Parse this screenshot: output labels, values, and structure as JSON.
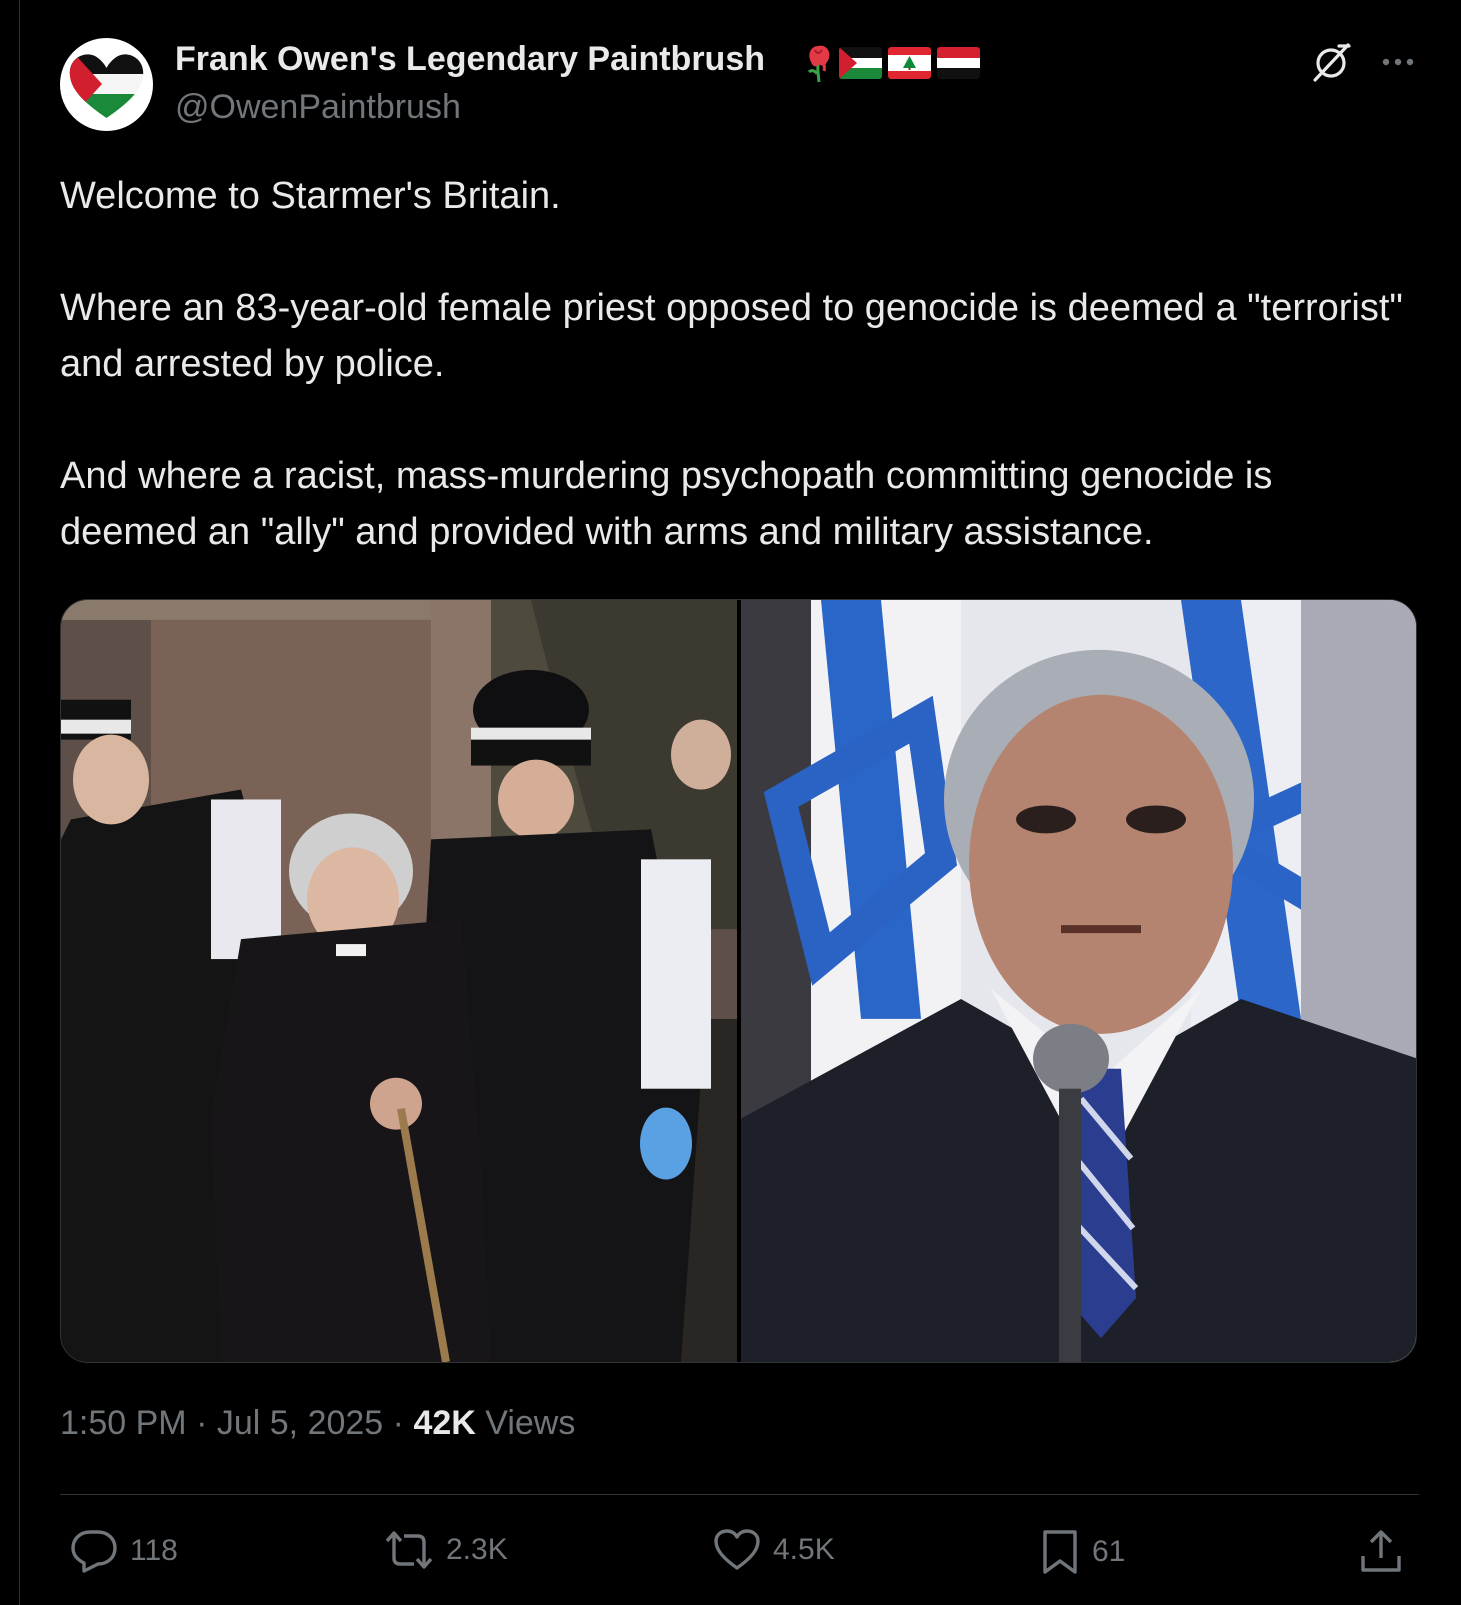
{
  "author": {
    "display_name": "Frank Owen's Legendary Paintbrush",
    "handle": "@OwenPaintbrush"
  },
  "tweet": {
    "paragraphs": [
      "Welcome to Starmer's Britain.",
      "Where an 83-year-old female priest opposed to genocide is deemed a \"terrorist\" and arrested by police.",
      "And where a racist, mass-murdering psychopath committing genocide is deemed an \"ally\" and provided with arms and military assistance."
    ]
  },
  "meta": {
    "time": "1:50 PM",
    "date": "Jul 5, 2025",
    "views_count": "42K",
    "views_label": "Views"
  },
  "actions": {
    "replies": "118",
    "reposts": "2.3K",
    "likes": "4.5K",
    "bookmarks": "61"
  },
  "icons": {
    "avatar": "palestine-flag-heart",
    "badges": [
      "melting-rose",
      "palestine-flag",
      "lebanon-flag",
      "yemen-flag"
    ],
    "header_right": [
      "grok-icon",
      "more-icon"
    ],
    "action_bar": [
      "reply-icon",
      "repost-icon",
      "like-icon",
      "bookmark-icon",
      "share-icon"
    ]
  },
  "colors": {
    "background": "#000000",
    "text": "#e7e9ea",
    "secondary_text": "#71767b",
    "border": "#2f3336"
  }
}
